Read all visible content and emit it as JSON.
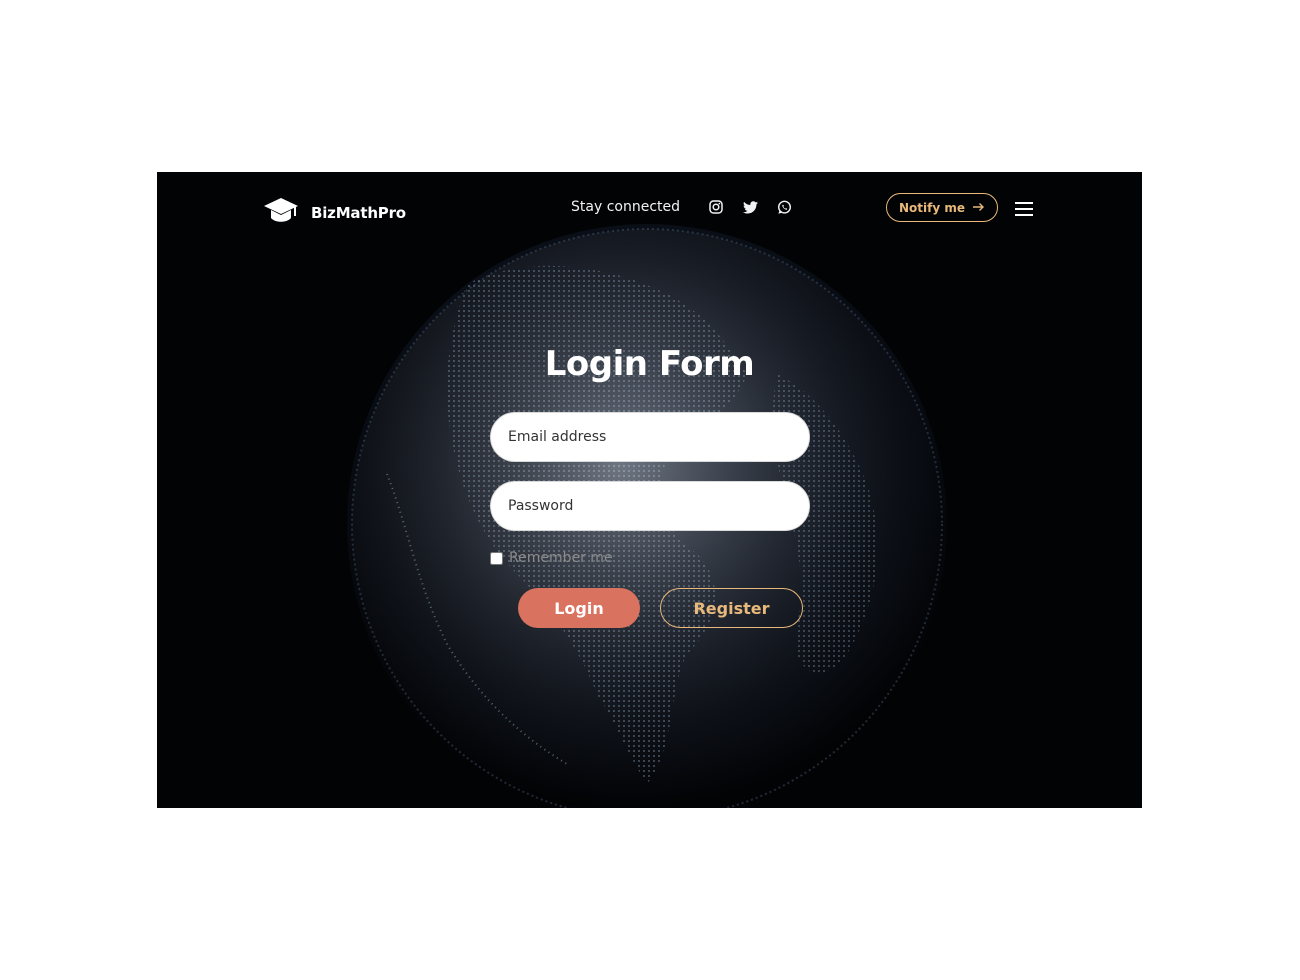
{
  "brand": {
    "name": "BizMathPro",
    "icon": "graduation-cap-icon"
  },
  "header": {
    "social_label": "Stay connected",
    "social_icons": [
      "instagram-icon",
      "twitter-icon",
      "whatsapp-icon"
    ],
    "notify_label": "Notify me",
    "notify_icon": "arrow-right-icon",
    "menu_icon": "hamburger-menu-icon"
  },
  "form": {
    "title": "Login Form",
    "email_placeholder": "Email address",
    "password_placeholder": "Password",
    "remember_label": "Remember me",
    "remember_checked": false,
    "login_label": "Login",
    "register_label": "Register"
  },
  "colors": {
    "accent_gold": "#e8b97a",
    "login_button": "#d9725f",
    "background": "#020305"
  }
}
